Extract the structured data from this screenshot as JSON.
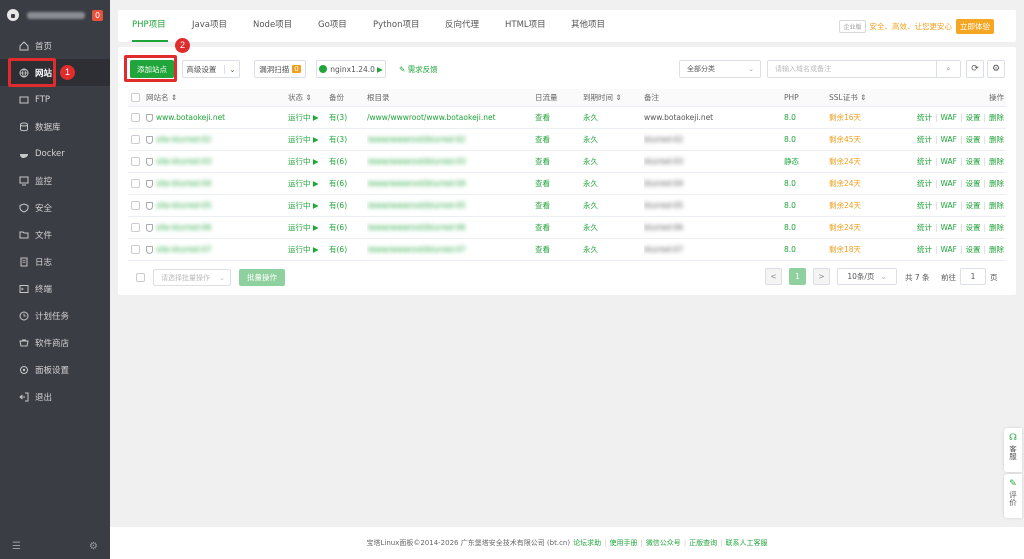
{
  "sidebar": {
    "badge": "0",
    "items": [
      {
        "label": "首页",
        "icon": "home-icon"
      },
      {
        "label": "网站",
        "icon": "globe-icon"
      },
      {
        "label": "FTP",
        "icon": "ftp-icon"
      },
      {
        "label": "数据库",
        "icon": "database-icon"
      },
      {
        "label": "Docker",
        "icon": "docker-icon"
      },
      {
        "label": "监控",
        "icon": "monitor-icon"
      },
      {
        "label": "安全",
        "icon": "shield-icon"
      },
      {
        "label": "文件",
        "icon": "folder-icon"
      },
      {
        "label": "日志",
        "icon": "log-icon"
      },
      {
        "label": "终端",
        "icon": "terminal-icon"
      },
      {
        "label": "计划任务",
        "icon": "clock-icon"
      },
      {
        "label": "软件商店",
        "icon": "store-icon"
      },
      {
        "label": "面板设置",
        "icon": "settings-icon"
      },
      {
        "label": "退出",
        "icon": "logout-icon"
      }
    ]
  },
  "annotations": {
    "one": "1",
    "two": "2"
  },
  "tabs": [
    "PHP项目",
    "Java项目",
    "Node项目",
    "Go项目",
    "Python项目",
    "反向代理",
    "HTML项目",
    "其他项目"
  ],
  "pro": {
    "tag": "企业版",
    "text": "安全、高效、让您更安心",
    "button": "立即体验"
  },
  "toolbar": {
    "add_site": "添加站点",
    "advanced": "高级设置",
    "scan": "漏洞扫描",
    "scan_count": "0",
    "nginx": "nginx1.24.0",
    "feedback": "需求反馈",
    "category": "全部分类",
    "search_placeholder": "请输入域名或备注"
  },
  "table": {
    "headers": [
      "网站名 ⇕",
      "状态 ⇕",
      "备份",
      "根目录",
      "日流量",
      "到期时间 ⇕",
      "备注",
      "PHP",
      "SSL证书 ⇕",
      "操作"
    ],
    "rows": [
      {
        "name": "www.botaokeji.net",
        "status": "运行中 ▶",
        "backup": "有(3)",
        "root": "/www/wwwroot/www.botaokeji.net",
        "traffic": "查看",
        "expire": "永久",
        "note": "www.botaokeji.net",
        "php": "8.0",
        "ssl": "剩余16天",
        "blurred": false
      },
      {
        "name": "site-blurred-02",
        "status": "运行中 ▶",
        "backup": "有(3)",
        "root": "/www/wwwroot/blurred-02",
        "traffic": "查看",
        "expire": "永久",
        "note": "blurred-02",
        "php": "8.0",
        "ssl": "剩余45天",
        "blurred": true
      },
      {
        "name": "site-blurred-03",
        "status": "运行中 ▶",
        "backup": "有(6)",
        "root": "/www/wwwroot/blurred-03",
        "traffic": "查看",
        "expire": "永久",
        "note": "blurred-03",
        "php": "静态",
        "ssl": "剩余24天",
        "blurred": true
      },
      {
        "name": "site-blurred-04",
        "status": "运行中 ▶",
        "backup": "有(6)",
        "root": "/www/wwwroot/blurred-04",
        "traffic": "查看",
        "expire": "永久",
        "note": "blurred-04",
        "php": "8.0",
        "ssl": "剩余24天",
        "blurred": true
      },
      {
        "name": "site-blurred-05",
        "status": "运行中 ▶",
        "backup": "有(6)",
        "root": "/www/wwwroot/blurred-05",
        "traffic": "查看",
        "expire": "永久",
        "note": "blurred-05",
        "php": "8.0",
        "ssl": "剩余24天",
        "blurred": true
      },
      {
        "name": "site-blurred-06",
        "status": "运行中 ▶",
        "backup": "有(6)",
        "root": "/www/wwwroot/blurred-06",
        "traffic": "查看",
        "expire": "永久",
        "note": "blurred-06",
        "php": "8.0",
        "ssl": "剩余24天",
        "blurred": true
      },
      {
        "name": "site-blurred-07",
        "status": "运行中 ▶",
        "backup": "有(6)",
        "root": "/www/wwwroot/blurred-07",
        "traffic": "查看",
        "expire": "永久",
        "note": "blurred-07",
        "php": "8.0",
        "ssl": "剩余18天",
        "blurred": true
      }
    ],
    "actions": [
      "统计",
      "WAF",
      "设置",
      "删除"
    ]
  },
  "bottom": {
    "batch_placeholder": "请选择批量操作",
    "batch_button": "批量操作",
    "page_prev": "<",
    "page_current": "1",
    "page_next": ">",
    "page_size": "10条/页",
    "total": "共 7 条",
    "goto_label": "前往",
    "goto_value": "1",
    "page_unit": "页"
  },
  "footer": {
    "copyright": "宝塔Linux面板©2014-2026 广东堡塔安全技术有限公司 (bt.cn)",
    "links": [
      "论坛求助",
      "使用手册",
      "微信公众号",
      "正版查询",
      "联系人工客服"
    ]
  },
  "float": {
    "service": "客服",
    "review": "评价"
  }
}
